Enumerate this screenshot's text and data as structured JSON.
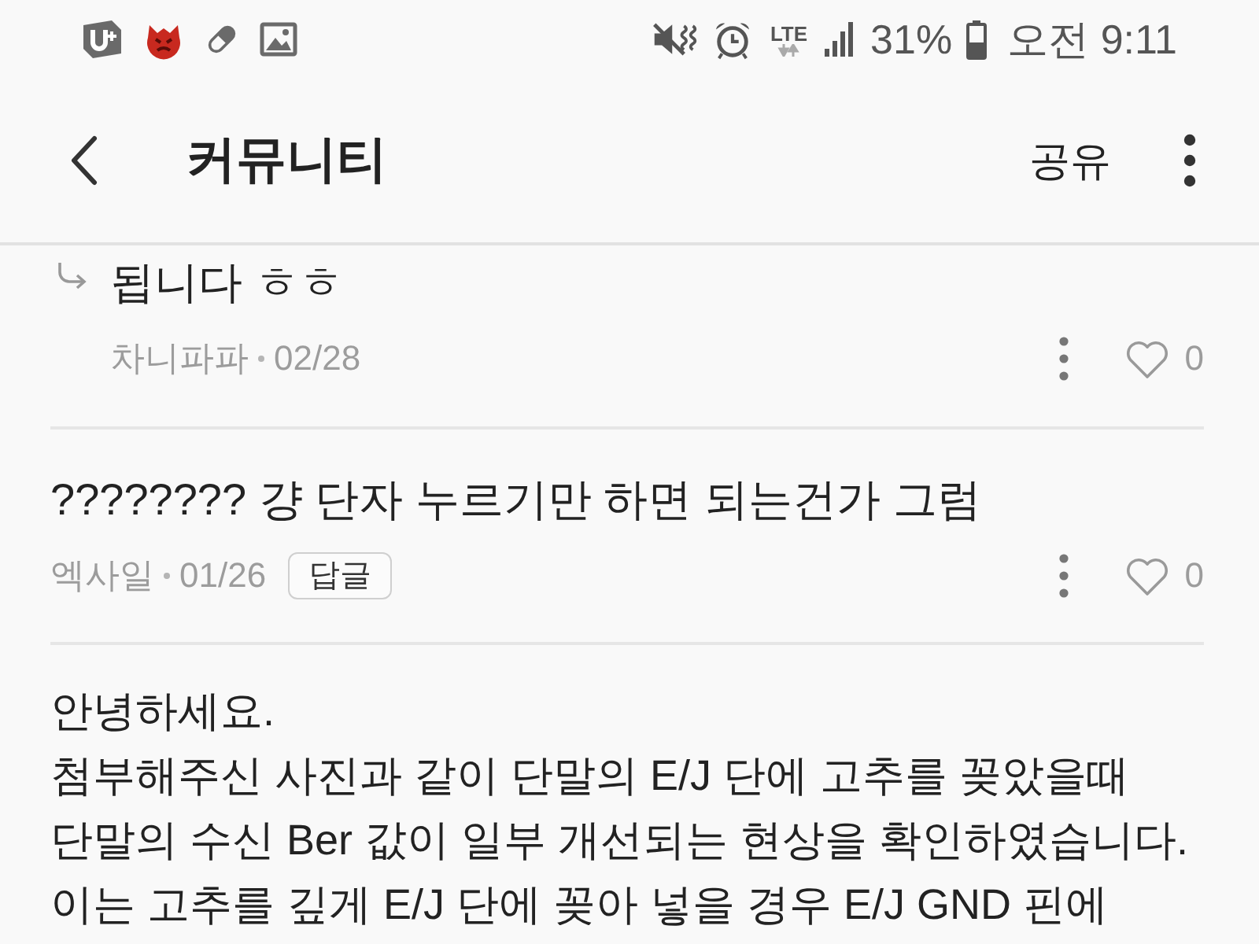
{
  "status_bar": {
    "network": "LTE",
    "battery": "31%",
    "time": "오전 9:11"
  },
  "app_bar": {
    "title": "커뮤니티",
    "action": "공유"
  },
  "comments": [
    {
      "kind": "reply",
      "text": "됩니다 ㅎㅎ",
      "author": "차니파파",
      "date": "02/28",
      "liked": false,
      "likes": "0"
    },
    {
      "kind": "comment",
      "text": "???????? 걍 단자 누르기만 하면 되는건가 그럼",
      "author": "엑사일",
      "date": "01/26",
      "reply_button": "답글",
      "liked": false,
      "likes": "0"
    }
  ],
  "post": {
    "body": "안녕하세요.\n첨부해주신 사진과 같이 단말의 E/J 단에 고추를 꽂았을때\n단말의 수신 Ber 값이 일부 개선되는 현상을 확인하였습니다.\n이는 고추를 깊게 E/J 단에 꽂아 넣을 경우 E/J GND 핀에"
  }
}
